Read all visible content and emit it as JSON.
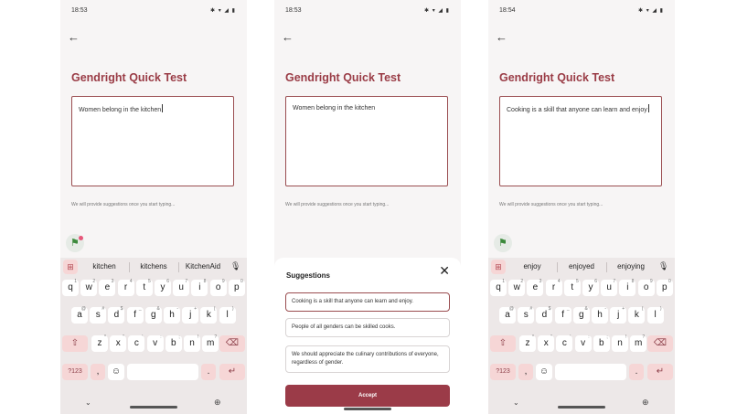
{
  "screens": [
    {
      "time": "18:53",
      "status_icons": "✱ ▾ ◢ ▮",
      "title": "Gendright Quick Test",
      "text": "Women belong in the kitchen",
      "hint": "We will provide suggestions once you start typing...",
      "suggestions": [
        "kitchen",
        "kitchens",
        "KitchenAid"
      ]
    },
    {
      "time": "18:53",
      "status_icons": "✱ ▾ ◢ ▮",
      "title": "Gendright Quick Test",
      "text": "Women belong in the kitchen",
      "hint": "We will provide suggestions once you start typing...",
      "sheet": {
        "heading": "Suggestions",
        "options": [
          "Cooking is a skill that anyone can learn and enjoy.",
          "People of all genders can be skilled cooks.",
          "We should appreciate the culinary contributions of everyone, regardless of gender."
        ],
        "accept_label": "Accept"
      }
    },
    {
      "time": "18:54",
      "status_icons": "✱ ▾ ◢ ▮",
      "title": "Gendright Quick Test",
      "text": "Cooking is a skill that anyone can learn and enjoy",
      "hint": "We will provide suggestions once you start typing...",
      "suggestions": [
        "enjoy",
        "enjoyed",
        "enjoying"
      ]
    }
  ],
  "keyboard": {
    "row1": [
      [
        "q",
        "1"
      ],
      [
        "w",
        "2"
      ],
      [
        "e",
        "3"
      ],
      [
        "r",
        "4"
      ],
      [
        "t",
        "5"
      ],
      [
        "y",
        "6"
      ],
      [
        "u",
        "7"
      ],
      [
        "i",
        "8"
      ],
      [
        "o",
        "9"
      ],
      [
        "p",
        "0"
      ]
    ],
    "row2": [
      [
        "a",
        "@"
      ],
      [
        "s",
        "#"
      ],
      [
        "d",
        "$"
      ],
      [
        "f",
        "_"
      ],
      [
        "g",
        "&"
      ],
      [
        "h",
        "-"
      ],
      [
        "j",
        "+"
      ],
      [
        "k",
        "("
      ],
      [
        "l",
        ")"
      ]
    ],
    "row3": [
      [
        "z",
        "*"
      ],
      [
        "x",
        "\""
      ],
      [
        "c",
        "'"
      ],
      [
        "v",
        ":"
      ],
      [
        "b",
        ";"
      ],
      [
        "n",
        "!"
      ],
      [
        "m",
        "?"
      ]
    ],
    "symbols_label": "?123",
    "comma": ",",
    "period": ".",
    "shift_glyph": "⇧",
    "backspace_glyph": "⌫",
    "enter_glyph": "↵",
    "emoji_glyph": "☺",
    "mic_glyph": "🎙",
    "grid_glyph": "⊞",
    "nav_down_glyph": "⌄",
    "globe_glyph": "⊕"
  },
  "colors": {
    "accent": "#9a3c46",
    "key_special": "#f6d6d6",
    "accept": "#9b3b48",
    "flag": "#3c8a3c"
  }
}
